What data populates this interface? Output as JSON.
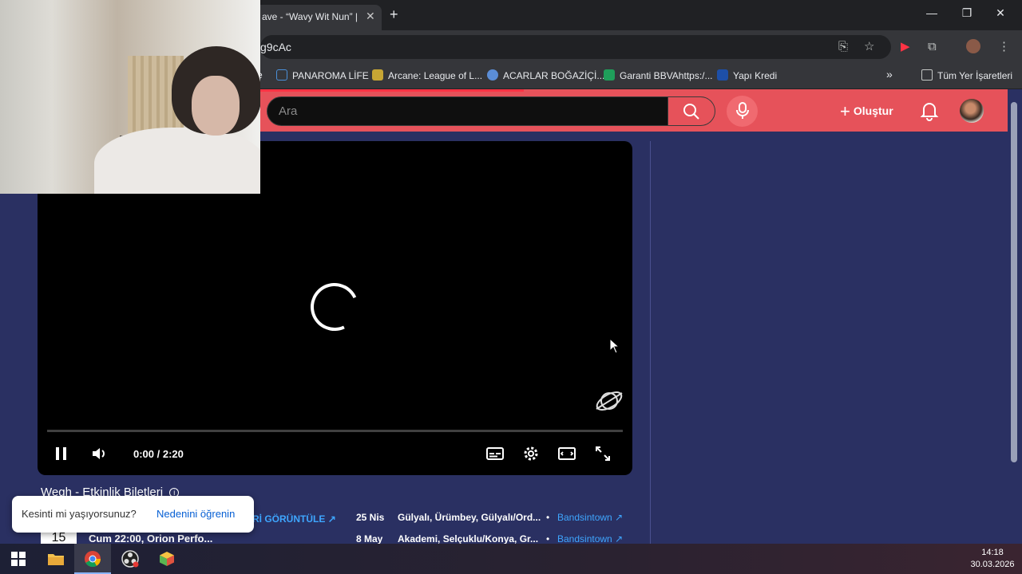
{
  "browser": {
    "tab_title": "ave - “Wavy Wit Nun” | D",
    "url_fragment": "g9cAc",
    "bookmarks": [
      {
        "label": "e",
        "color": "#35363a"
      },
      {
        "label": "PANAROMA LİFE",
        "color": "#4a90d9"
      },
      {
        "label": "Arcane: League of L...",
        "color": "#c7a634"
      },
      {
        "label": "ACARLAR BOĞAZİÇİ...",
        "color": "#5b8dd6"
      },
      {
        "label": "Garanti BBVAhttps:/...",
        "color": "#1f9e5a"
      },
      {
        "label": "Yapı Kredi",
        "color": "#1d4fa8"
      }
    ],
    "all_bookmarks": "Tüm Yer İşaretleri",
    "more_glyph": "»"
  },
  "header": {
    "search_placeholder": "Ara",
    "create_label": "Oluştur"
  },
  "player": {
    "time": "0:00 / 2:20",
    "progress": 0
  },
  "events": {
    "title": "Wegh - Etkinlik Biletleri",
    "view_all": "Rİ GÖRÜNTÜLE",
    "rows": [
      {
        "date": "25 Nis",
        "location": "Gülyalı, Ürümbey, Gülyalı/Ord...",
        "source": "Bandsintown"
      },
      {
        "date": "8 May",
        "location": "Akademi, Selçuklu/Konya, Gr...",
        "source": "Bandsintown"
      }
    ],
    "day_box": "15",
    "sub_line": "Cum 22:00, Orion Perfo..."
  },
  "toast": {
    "question": "Kesinti mi yaşıyorsunuz?",
    "link": "Nedenini öğrenin"
  },
  "taskbar": {
    "time": "14:18",
    "date": "30.03.2026"
  }
}
